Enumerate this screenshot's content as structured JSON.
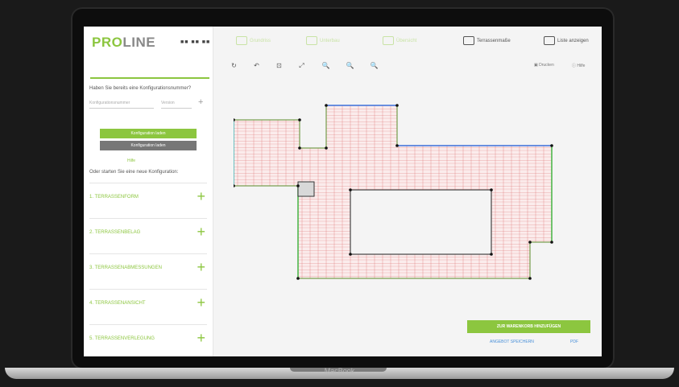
{
  "device": {
    "brand": "MacBook"
  },
  "logo": {
    "part1": "PRO",
    "part2": "LINE"
  },
  "flags": "■■ ■■ ■■",
  "sidebar": {
    "question": "Haben Sie bereits eine Konfigurationsnummer?",
    "config_placeholder": "Konfigurationsnummer",
    "version_placeholder": "Version",
    "btn_load": "Konfiguration laden",
    "btn_import": "Konfiguration laden",
    "small_link": "Hilfe",
    "start_text": "Oder starten Sie eine neue Konfiguration:",
    "sections": [
      {
        "label": "1. TERRASSENFORM"
      },
      {
        "label": "2. TERRASSENBELAG"
      },
      {
        "label": "3. TERRASSENABMESSUNGEN"
      },
      {
        "label": "4. TERRASSENANSICHT"
      },
      {
        "label": "5. TERRASSENVERLEGUNG"
      }
    ]
  },
  "topnav": {
    "items": [
      {
        "label": "Grundriss",
        "active": false
      },
      {
        "label": "Unterbau",
        "active": false
      },
      {
        "label": "Übersicht",
        "active": false
      },
      {
        "label": "Terrassenmaße",
        "active": true
      },
      {
        "label": "Liste anzeigen",
        "active": true
      }
    ]
  },
  "toolbar": {
    "icons": [
      "↻",
      "↶",
      "⊡",
      "⤢",
      "🔍",
      "🔍",
      "🔍"
    ]
  },
  "right_tools": {
    "print": "Drucken",
    "help": "Hilfe"
  },
  "cta": {
    "label": "ZUR WARENKORB HINZUFÜGEN"
  },
  "links": {
    "save": "ANGEBOT SPEICHERN",
    "pdf": "PDF"
  },
  "colors": {
    "accent": "#8cc63f",
    "link": "#4a90d9"
  }
}
